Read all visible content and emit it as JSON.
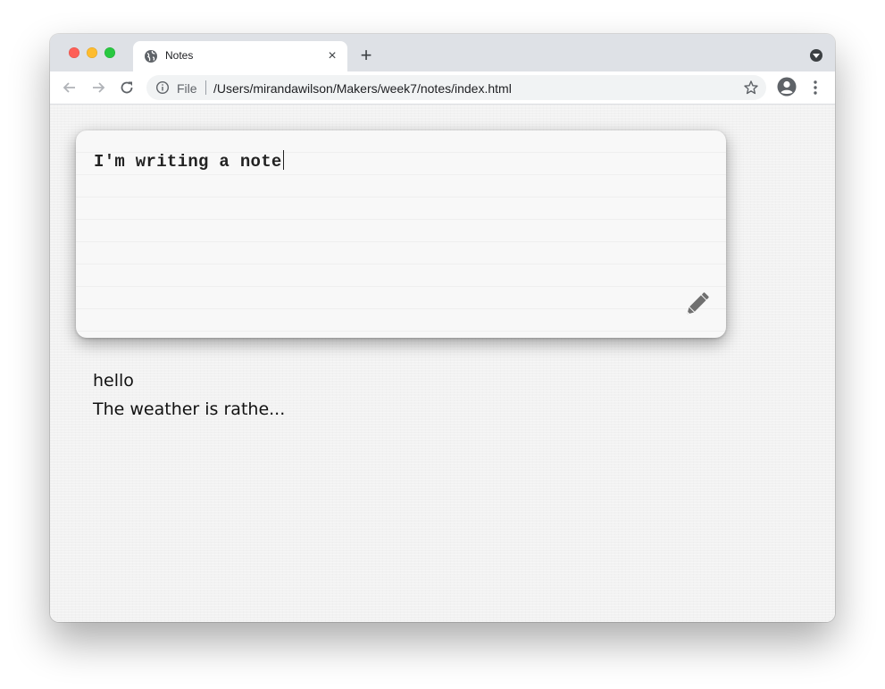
{
  "browser": {
    "tab": {
      "title": "Notes",
      "close_glyph": "×"
    },
    "new_tab_glyph": "+",
    "address": {
      "scheme_label": "File",
      "url": "/Users/mirandawilson/Makers/week7/notes/index.html"
    },
    "icons": [
      "globe-icon",
      "close-icon",
      "plus-icon",
      "back-arrow-icon",
      "forward-arrow-icon",
      "reload-icon",
      "info-icon",
      "star-icon",
      "profile-icon",
      "more-vert-icon",
      "tab-search-icon"
    ],
    "traffic_light_colors": {
      "close": "#fe5f57",
      "minimize": "#febc2e",
      "maximize": "#28c840"
    }
  },
  "note_editor": {
    "value": "I'm writing a note",
    "submit_icon": "pencil-icon"
  },
  "notes": [
    {
      "text": "hello"
    },
    {
      "text": "The weather is rathe..."
    }
  ]
}
